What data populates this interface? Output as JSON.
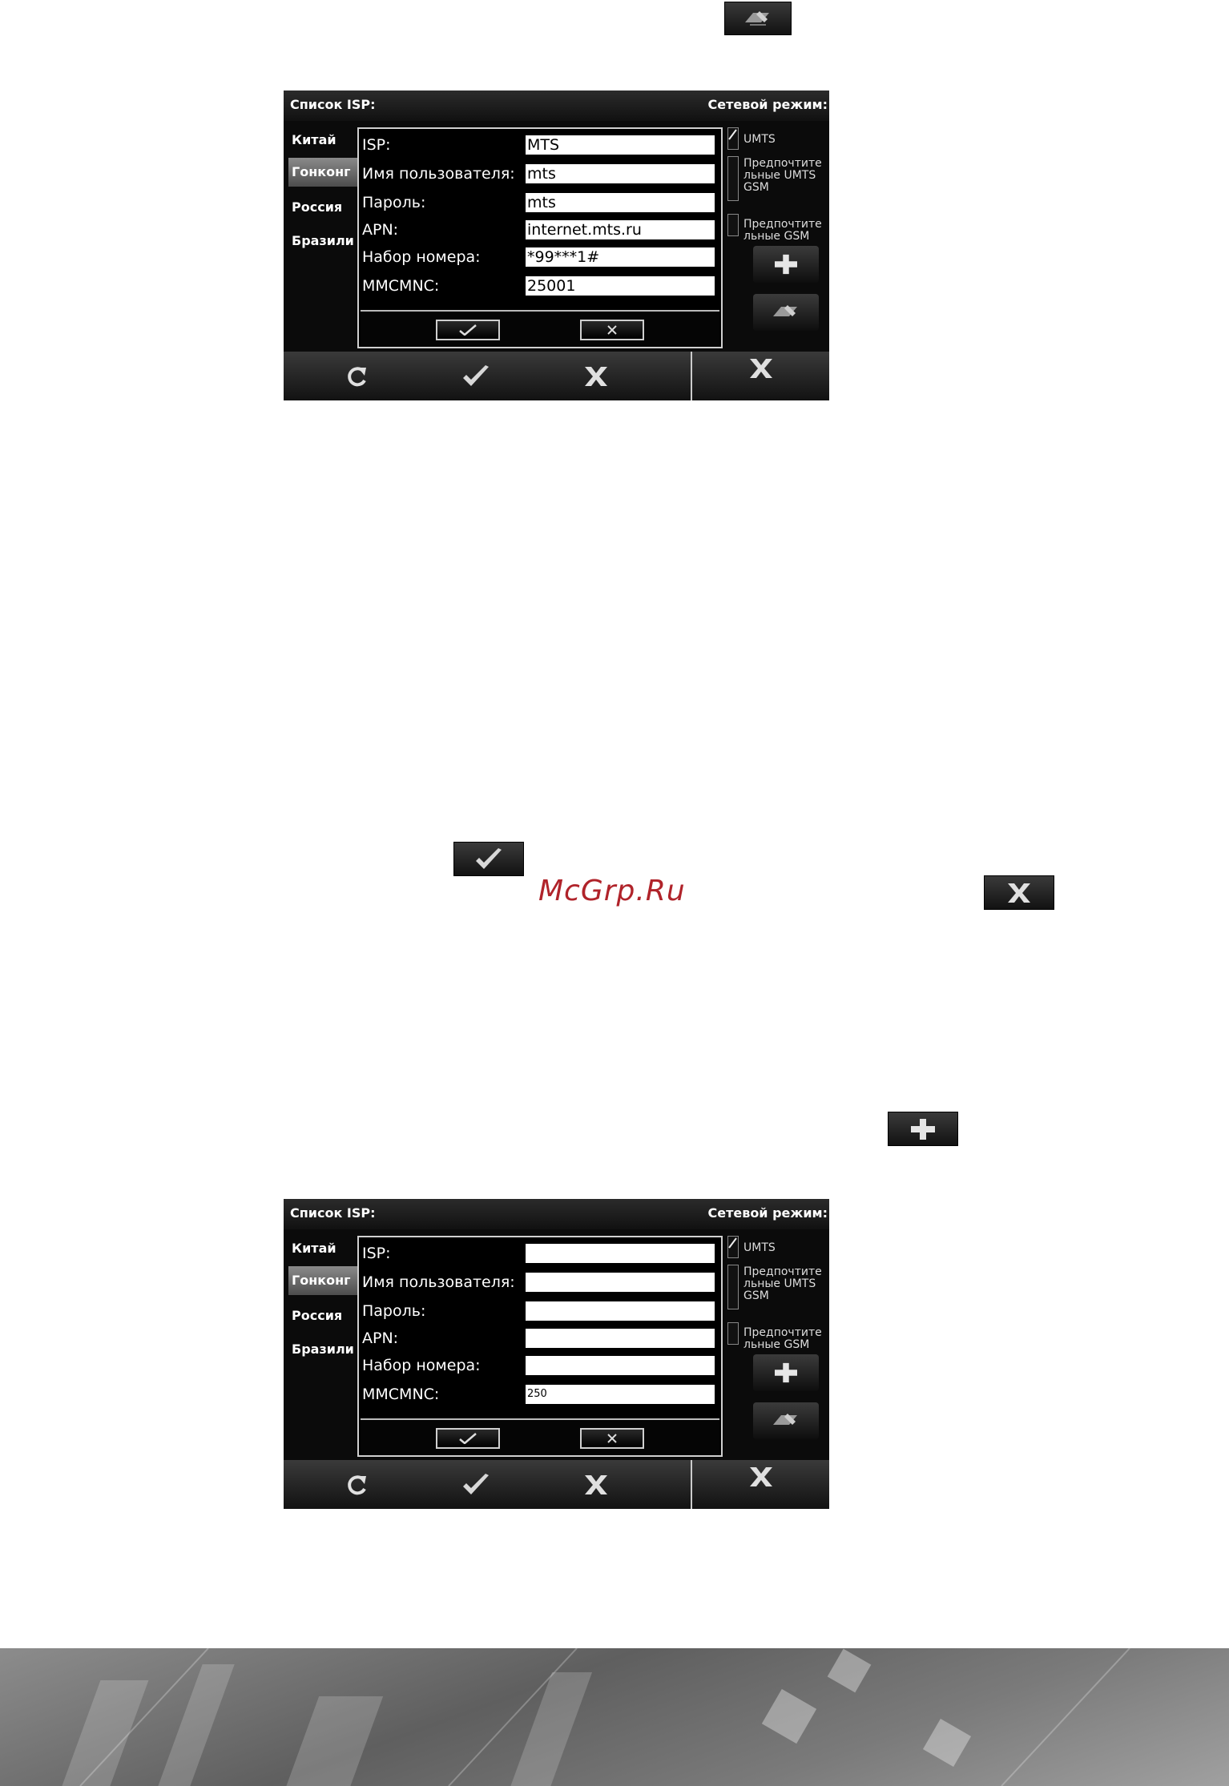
{
  "watermark": "McGrp.Ru",
  "screens": [
    {
      "title_left": "Список ISP:",
      "title_right": "Сетевой режим:",
      "countries": [
        {
          "label": "Китай",
          "selected": false
        },
        {
          "label": "Гонконг",
          "selected": true
        },
        {
          "label": "Россия",
          "selected": false
        },
        {
          "label": "Бразили",
          "selected": false
        }
      ],
      "fields": [
        {
          "label": "ISP:",
          "value": "MTS"
        },
        {
          "label": "Имя пользователя:",
          "value": "mts"
        },
        {
          "label": "Пароль:",
          "value": "mts"
        },
        {
          "label": "APN:",
          "value": "internet.mts.ru"
        },
        {
          "label": "Набор номера:",
          "value": "*99***1#"
        },
        {
          "label": "MMCMNC:",
          "value": "25001"
        }
      ],
      "modes": [
        {
          "label": "UMTS",
          "checked": true
        },
        {
          "label": "Предпочтите льные UMTS GSM",
          "checked": false
        },
        {
          "label": "Предпочтите льные GSM",
          "checked": false
        }
      ]
    },
    {
      "title_left": "Список ISP:",
      "title_right": "Сетевой режим:",
      "countries": [
        {
          "label": "Китай",
          "selected": false
        },
        {
          "label": "Гонконг",
          "selected": true
        },
        {
          "label": "Россия",
          "selected": false
        },
        {
          "label": "Бразили",
          "selected": false
        }
      ],
      "fields": [
        {
          "label": "ISP:",
          "value": ""
        },
        {
          "label": "Имя пользователя:",
          "value": ""
        },
        {
          "label": "Пароль:",
          "value": ""
        },
        {
          "label": "APN:",
          "value": ""
        },
        {
          "label": "Набор номера:",
          "value": ""
        },
        {
          "label": "MMCMNC:",
          "value": "250"
        }
      ],
      "modes": [
        {
          "label": "UMTS",
          "checked": true
        },
        {
          "label": "Предпочтите льные UMTS GSM",
          "checked": false
        },
        {
          "label": "Предпочтите льные GSM",
          "checked": false
        }
      ]
    }
  ],
  "icons": {
    "inline_top": "edit-icon",
    "inline_check": "check-icon",
    "inline_close": "close-icon",
    "inline_add": "plus-icon"
  },
  "colors": {
    "watermark": "#b0232a",
    "selected_country": "#6e6e6e"
  }
}
